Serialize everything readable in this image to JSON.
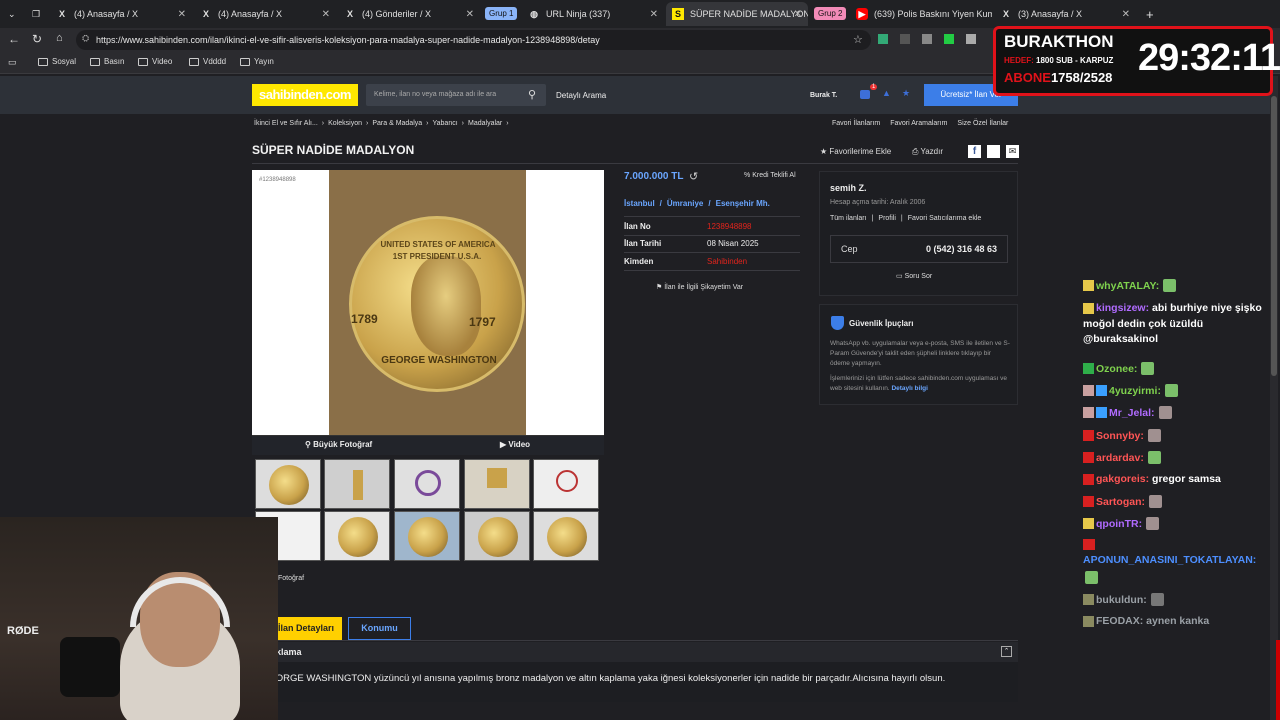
{
  "browser": {
    "tabs": [
      {
        "label": "(4) Anasayfa / X",
        "icon": "x-logo"
      },
      {
        "label": "(4) Anasayfa / X",
        "icon": "x-logo"
      },
      {
        "label": "(4) Gönderiler / X",
        "icon": "x-logo"
      },
      {
        "label": "URL Ninja (337)",
        "icon": "globe"
      },
      {
        "label": "SÜPER NADİDE MADALYON s",
        "icon": "sahibinden"
      },
      {
        "label": "(639) Polis Baskını Yiyen Kum",
        "icon": "youtube"
      },
      {
        "label": "(3) Anasayfa / X",
        "icon": "x-logo"
      }
    ],
    "groups": [
      "Grup 1",
      "Grup 2"
    ],
    "url": "https://www.sahibinden.com/ilan/ikinci-el-ve-sifir-alisveris-koleksiyon-para-madalya-super-nadide-madalyon-1238948898/detay",
    "bookmarks": [
      "Sosyal",
      "Basın",
      "Video",
      "Vdddd",
      "Yayın"
    ]
  },
  "site": {
    "logo": "sahibinden.com",
    "search_placeholder": "Kelime, ilan no veya mağaza adı ile ara",
    "detailed_search": "Detaylı Arama",
    "user": "Burak T.",
    "notif_count": "1",
    "post_button": "Ücretsiz* İlan Ver",
    "breadcrumb": [
      "İkinci El ve Sıfır Alı...",
      "Koleksiyon",
      "Para & Madalya",
      "Yabancı",
      "Madalyalar"
    ],
    "header_links": [
      "Favori İlanlarım",
      "Favori Aramalarım",
      "Size Özel İlanlar"
    ],
    "title": "SÜPER NADİDE MADALYON",
    "fav_add": "Favorilerime Ekle",
    "print": "Yazdır",
    "photo_id": "#1238948898",
    "big_photo": "Büyük Fotoğraf",
    "video": "Video",
    "photo_count_label": "Fotoğraf",
    "price": "7.000.000 TL",
    "credit_offer": "Kredi Teklifi Al",
    "location": [
      "İstanbul",
      "Ümraniye",
      "Esenşehir Mh."
    ],
    "details": [
      {
        "k": "İlan No",
        "v": "1238948898",
        "red": true
      },
      {
        "k": "İlan Tarihi",
        "v": "08 Nisan 2025",
        "red": false
      },
      {
        "k": "Kimden",
        "v": "Sahibinden",
        "red": true
      }
    ],
    "complaint": "İlan ile İlgili Şikayetim Var",
    "seller": {
      "name": "semih Z.",
      "since": "Hesap açma tarihi: Aralık 2006",
      "links": [
        "Tüm ilanları",
        "Profili",
        "Favori Satıcılarıma ekle"
      ],
      "phone_label": "Cep",
      "phone": "0 (542) 316 48 63",
      "ask": "Soru Sor"
    },
    "security": {
      "title": "Güvenlik İpuçları",
      "text1": "WhatsApp vb. uygulamalar veya e-posta, SMS ile iletilen ve S-Param Güvende'yi taklit eden şüpheli linklere tıklayıp bir ödeme yapmayın.",
      "text2": "İşlemlerinizi için lütfen sadece sahibinden.com uygulaması ve web sitesini kullanın.",
      "more": "Detaylı bilgi"
    },
    "tabs": [
      "İlan Detayları",
      "Konumu"
    ],
    "desc_title": "Açıklama",
    "desc": "GEORGE WASHINGTON yüzüncü yıl anısına yapılmış bronz madalyon ve altın kaplama yaka iğnesi koleksiyonerler için nadide bir parçadır.Alıcısına hayırlı olsun."
  },
  "coin": {
    "top": "UNITED STATES OF AMERICA",
    "sub": "1ST PRESIDENT U.S.A.",
    "left_year": "1789",
    "right_year": "1797",
    "bottom": "GEORGE WASHINGTON"
  },
  "overlay": {
    "name": "BURAKTHON",
    "hedef_label": "HEDEF:",
    "hedef": "1800 SUB - KARPUZ",
    "abone_label": "ABONE",
    "abone": "1758/2528",
    "timer": "29:32:11"
  },
  "mic_brand": "RØDE",
  "chat": [
    {
      "user": "whyATALAY:",
      "msg": "",
      "color": "#7fd24e"
    },
    {
      "user": "kingsizew:",
      "msg": "abi burhiye niye şişko moğol dedin çok üzüldü @buraksakinol",
      "color": "#b06bff"
    },
    {
      "user": "Ozonee:",
      "msg": "",
      "color": "#7fd24e"
    },
    {
      "user": "4yuzyirmi:",
      "msg": "",
      "color": "#7fd24e"
    },
    {
      "user": "Mr_Jelal:",
      "msg": "",
      "color": "#b06bff"
    },
    {
      "user": "Sonnyby:",
      "msg": "",
      "color": "#ff5555"
    },
    {
      "user": "ardardav:",
      "msg": "",
      "color": "#ff5555"
    },
    {
      "user": "gakgoreis:",
      "msg": "gregor samsa",
      "color": "#ff5555"
    },
    {
      "user": "Sartogan:",
      "msg": "",
      "color": "#ff5555"
    },
    {
      "user": "qpoinTR:",
      "msg": "",
      "color": "#b06bff"
    },
    {
      "user": "APONUN_ANASINI_TOKATLAYAN:",
      "msg": "",
      "color": "#4d8fff"
    },
    {
      "user": "bukuldun:",
      "msg": "",
      "color": "#9aa0a6"
    },
    {
      "user": "FEODAX:",
      "msg": "aynen kanka",
      "color": "#9aa0a6"
    }
  ]
}
